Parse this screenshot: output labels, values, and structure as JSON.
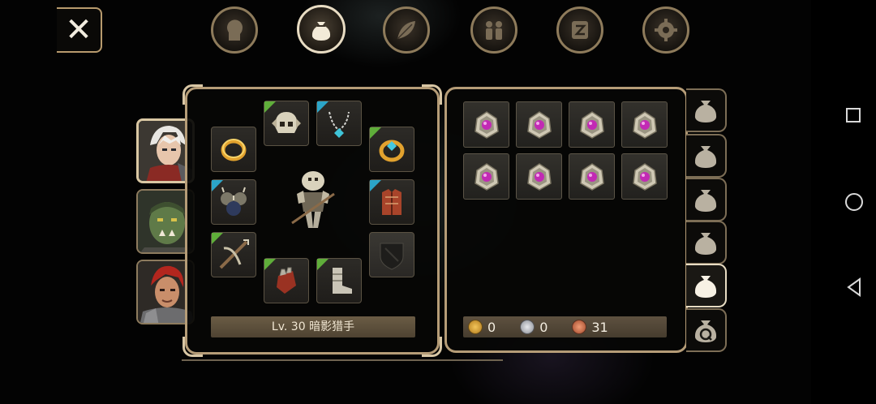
{
  "header": {
    "close_icon": "close-icon",
    "tabs": [
      {
        "name": "tab-character",
        "icon": "head-icon",
        "active": false
      },
      {
        "name": "tab-inventory",
        "icon": "bag-icon",
        "active": true
      },
      {
        "name": "tab-skills",
        "icon": "leaf-icon",
        "active": false
      },
      {
        "name": "tab-party",
        "icon": "people-icon",
        "active": false
      },
      {
        "name": "tab-quests",
        "icon": "scroll-icon",
        "active": false
      },
      {
        "name": "tab-settings",
        "icon": "gear-icon",
        "active": false
      }
    ]
  },
  "party": [
    {
      "name": "white-haired-hero",
      "active": true
    },
    {
      "name": "orc-warrior",
      "active": false
    },
    {
      "name": "red-haired-fighter",
      "active": false
    }
  ],
  "equipment": {
    "character_label": "Lv. 30 暗影猎手",
    "slots": [
      {
        "name": "ring-slot-left",
        "icon": "gold-ring-icon",
        "rarity": ""
      },
      {
        "name": "helmet-slot",
        "icon": "skull-helmet-icon",
        "rarity": "green"
      },
      {
        "name": "necklace-slot",
        "icon": "necklace-icon",
        "rarity": "blue"
      },
      {
        "name": "ring-slot-right",
        "icon": "gem-ring-icon",
        "rarity": "green"
      },
      {
        "name": "shoulder-slot",
        "icon": "spiked-shoulder-icon",
        "rarity": "blue"
      },
      {
        "name": "armor-slot",
        "icon": "red-armor-icon",
        "rarity": "blue"
      },
      {
        "name": "weapon-slot",
        "icon": "crossbow-icon",
        "rarity": "green"
      },
      {
        "name": "shield-slot",
        "icon": "empty-shield-icon",
        "rarity": ""
      },
      {
        "name": "gloves-slot",
        "icon": "gauntlet-icon",
        "rarity": "green"
      },
      {
        "name": "boots-slot",
        "icon": "boots-icon",
        "rarity": "green"
      }
    ]
  },
  "inventory": {
    "items": [
      {
        "icon": "orb-relic-icon"
      },
      {
        "icon": "orb-relic-icon"
      },
      {
        "icon": "orb-relic-icon"
      },
      {
        "icon": "orb-relic-icon"
      },
      {
        "icon": "orb-relic-icon"
      },
      {
        "icon": "orb-relic-icon"
      },
      {
        "icon": "orb-relic-icon"
      },
      {
        "icon": "orb-relic-icon"
      }
    ],
    "currency": {
      "gold": "0",
      "silver": "0",
      "copper": "31"
    }
  },
  "side_tabs": [
    {
      "name": "bag-tab-1",
      "icon": "bag-icon",
      "active": false
    },
    {
      "name": "bag-tab-2",
      "icon": "bag-icon",
      "active": false
    },
    {
      "name": "bag-tab-3",
      "icon": "bag-icon",
      "active": false
    },
    {
      "name": "bag-tab-4",
      "icon": "bag-icon",
      "active": false
    },
    {
      "name": "bag-tab-5",
      "icon": "bag-icon",
      "active": true
    },
    {
      "name": "quest-bag-tab",
      "icon": "quest-bag-icon",
      "active": false
    }
  ],
  "colors": {
    "frame": "#b59c77",
    "rarity_green": "#5fae3a",
    "rarity_blue": "#2ba5c8",
    "gold": "#d8a23a",
    "silver": "#b9bcc3",
    "copper": "#c8714c"
  }
}
